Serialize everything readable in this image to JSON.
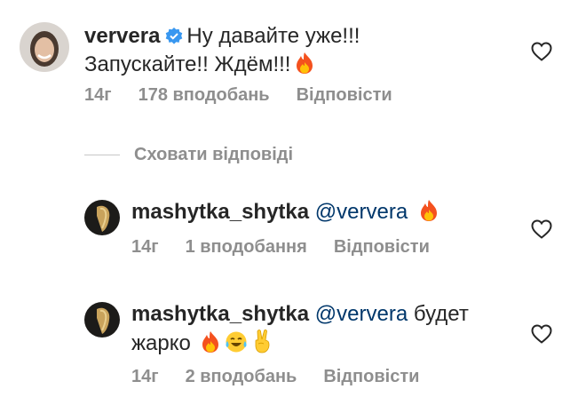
{
  "comments": [
    {
      "username": "ververa",
      "verified": true,
      "line1": "Ну давайте уже!!!",
      "line2": "Запускайте!! Ждём!!!",
      "time": "14г",
      "likes": "178 вподобань",
      "reply": "Відповісти"
    }
  ],
  "hide_replies": "Сховати відповіді",
  "replies": [
    {
      "username": "mashytka_shytka",
      "mention": "@ververa",
      "time": "14г",
      "likes": "1 вподобання",
      "reply": "Відповісти"
    },
    {
      "username": "mashytka_shytka",
      "mention": "@ververa",
      "after_mention": "будет",
      "line2": "жарко",
      "time": "14г",
      "likes": "2 вподобань",
      "reply": "Відповісти"
    }
  ],
  "icons": {
    "verified": "verified-badge-icon",
    "like": "heart-outline-icon",
    "fire": "fire-emoji",
    "laugh": "tears-of-joy-emoji",
    "victory": "victory-hand-emoji"
  },
  "colors": {
    "text": "#262626",
    "muted": "#8e8e8e",
    "mention": "#00376b",
    "verified": "#3897f0"
  }
}
